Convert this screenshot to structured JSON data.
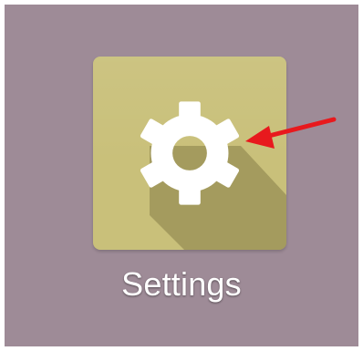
{
  "app_tile": {
    "label": "Settings",
    "icon": "gear-icon",
    "tile_color": "#c9c07a",
    "background_color": "#9e8b97"
  },
  "annotation": {
    "icon": "red-arrow-icon",
    "color": "#e8191d"
  }
}
